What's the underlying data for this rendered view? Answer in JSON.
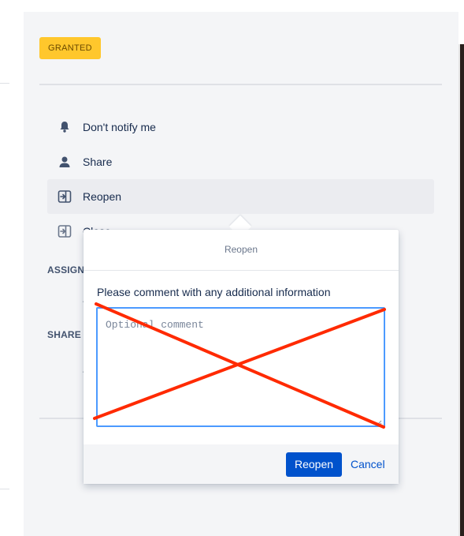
{
  "status_badge": "GRANTED",
  "menu": {
    "items": [
      {
        "label": "Don't notify me",
        "icon": "bell-icon"
      },
      {
        "label": "Share",
        "icon": "user-icon"
      },
      {
        "label": "Reopen",
        "icon": "reopen-icon",
        "active": true
      },
      {
        "label": "Close",
        "icon": "close-request-icon"
      }
    ]
  },
  "sections": {
    "assignee_label": "ASSIGN",
    "shared_label": "SHARE"
  },
  "dialog": {
    "title": "Reopen",
    "prompt": "Please comment with any additional information",
    "comment_placeholder": "Optional comment",
    "submit_label": "Reopen",
    "cancel_label": "Cancel"
  },
  "colors": {
    "badge": "#ffc72c",
    "primary": "#0052cc",
    "focus_border": "#4c9aff",
    "annotation_cross": "#ff2a00"
  }
}
